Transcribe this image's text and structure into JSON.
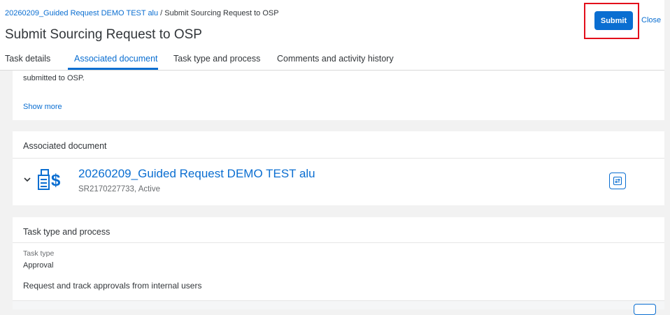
{
  "header": {
    "breadcrumb_link": "20260209_Guided Request DEMO TEST alu",
    "breadcrumb_separator": " / ",
    "breadcrumb_current": "Submit Sourcing Request to OSP",
    "title": "Submit Sourcing Request to OSP",
    "submit_label": "Submit",
    "close_label": "Close"
  },
  "tabs": [
    {
      "label": "Task details",
      "active": false
    },
    {
      "label": "Associated document",
      "active": true
    },
    {
      "label": "Task type and process",
      "active": false
    },
    {
      "label": "Comments and activity history",
      "active": false
    }
  ],
  "task_details": {
    "text": "submitted to OSP.",
    "show_more": "Show more"
  },
  "associated_document": {
    "heading": "Associated document",
    "doc_title": "20260209_Guided Request DEMO TEST alu",
    "doc_subtitle": "SR2170227733, Active",
    "icon": "sourcing-request-icon"
  },
  "task_type": {
    "heading": "Task type and process",
    "label": "Task type",
    "value": "Approval",
    "description": "Request and track approvals from internal users"
  },
  "colors": {
    "accent": "#0a6ed1",
    "highlight": "#e30e1b",
    "background": "#f2f2f2"
  }
}
